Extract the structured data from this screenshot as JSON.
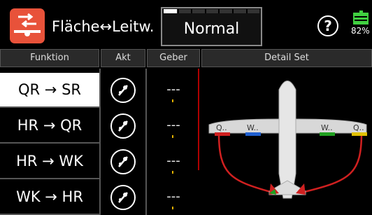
{
  "header": {
    "app_icon": "aileron-flap-mix-icon",
    "title": "Fläche↔Leitw.",
    "mode_label": "Normal",
    "mode_level": 0.14,
    "help_label": "?",
    "battery_percent": "82%",
    "battery_color": "#40d040",
    "accent_color": "#e8523a"
  },
  "columns": {
    "funktion": "Funktion",
    "akt": "Akt",
    "geber": "Geber",
    "detail": "Detail Set"
  },
  "rows": [
    {
      "function": "QR → SR",
      "selected": true,
      "akt_icon": "switch-off-icon",
      "geber": "---"
    },
    {
      "function": "HR → QR",
      "selected": false,
      "akt_icon": "switch-off-icon",
      "geber": "---"
    },
    {
      "function": "HR → WK",
      "selected": false,
      "akt_icon": "switch-off-icon",
      "geber": "---"
    },
    {
      "function": "WK → HR",
      "selected": false,
      "akt_icon": "switch-off-icon",
      "geber": "---"
    }
  ],
  "detail": {
    "wing_labels": [
      "Q..",
      "W..",
      "W..",
      "Q.."
    ],
    "wing_colors": [
      "#d02020",
      "#2060d0",
      "#20a020",
      "#e0c000"
    ],
    "mix_line_color": "#d02020"
  }
}
